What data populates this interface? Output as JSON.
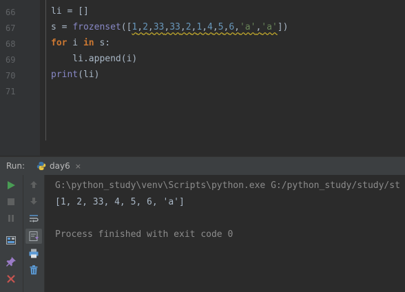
{
  "editor": {
    "line_numbers": [
      "66",
      "67",
      "68",
      "69",
      "70",
      "71"
    ],
    "lines": {
      "l66": [
        "li",
        " = ",
        "[]"
      ],
      "l67": [
        "s",
        " = ",
        "frozenset",
        "([",
        "1",
        ",",
        "2",
        ",",
        "33",
        ",",
        "33",
        ",",
        "2",
        ",",
        "1",
        ",",
        "4",
        ",",
        "5",
        ",",
        "6",
        ",",
        "'a'",
        ",",
        "'a'",
        "])"
      ],
      "l68": [
        "for",
        " i ",
        "in",
        " s:"
      ],
      "l69": [
        "    li.append(i)"
      ],
      "l70": [
        "print",
        "(li)"
      ]
    }
  },
  "run_bar": {
    "label": "Run:",
    "tab_name": "day6",
    "tab_close": "×"
  },
  "console": {
    "command": "G:\\python_study\\venv\\Scripts\\python.exe G:/python_study/study/st",
    "output": "[1, 2, 33, 4, 5, 6, 'a']",
    "exit_message": "Process finished with exit code 0"
  },
  "toolbar": {
    "left_icons": [
      "run-icon",
      "stop-icon",
      "pause-icon",
      "layout-icon",
      "pin-icon",
      "close-icon"
    ],
    "right_icons": [
      "up-arrow-icon",
      "down-arrow-icon",
      "soft-wrap-icon",
      "scroll-to-end-icon",
      "print-icon",
      "trash-icon"
    ]
  },
  "colors": {
    "background": "#2b2b2b",
    "keyword": "#cc7832",
    "builtin": "#8888c6",
    "number": "#6897bb",
    "string": "#6a8759",
    "run_green": "#499c54",
    "close_red": "#c75450"
  }
}
